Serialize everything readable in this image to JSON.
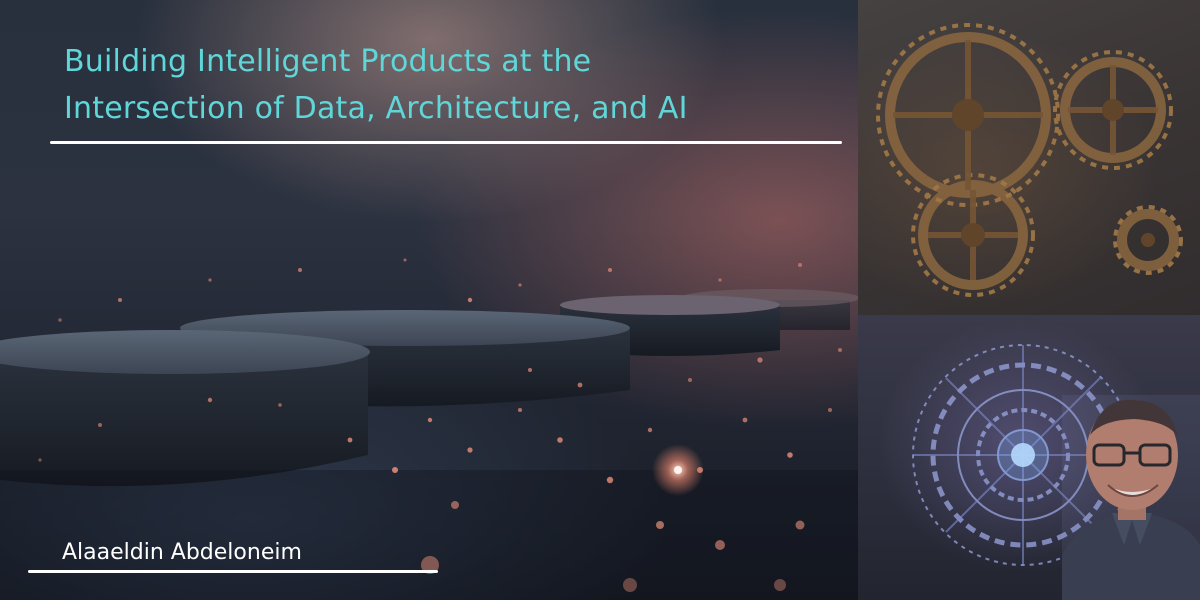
{
  "banner": {
    "title_lines": [
      "Building Intelligent Products at the",
      "Intersection of Data, Architecture, and AI"
    ],
    "author": "Alaaeldin Abdeloneim"
  },
  "colors": {
    "title": "#5fd6d8",
    "rule": "#ffffff",
    "author": "#ffffff",
    "sparkle": "#e8907a"
  },
  "images": {
    "hero": "glowing-particles-stone-discs",
    "top_right": "steampunk-gears",
    "bottom_right": "holographic-mechanism",
    "portrait": "author-portrait"
  }
}
